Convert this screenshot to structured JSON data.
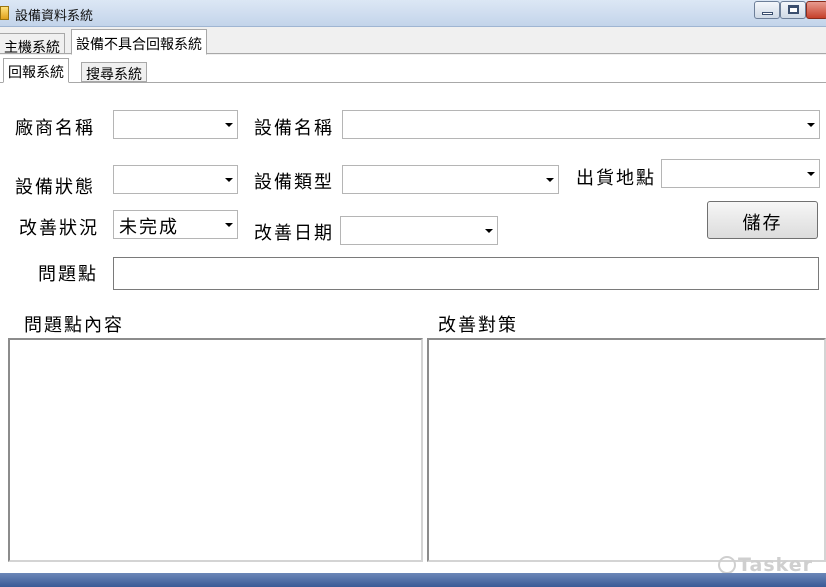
{
  "window": {
    "title": "設備資料系統"
  },
  "outer_tabs": [
    {
      "label": "主機系統"
    },
    {
      "label": "設備不具合回報系統"
    }
  ],
  "inner_tabs": [
    {
      "label": "回報系統"
    },
    {
      "label": "搜尋系統"
    }
  ],
  "form": {
    "vendor_label": "廠商名稱",
    "vendor_value": "",
    "equipment_name_label": "設備名稱",
    "equipment_name_value": "",
    "equipment_status_label": "設備狀態",
    "equipment_status_value": "",
    "equipment_type_label": "設備類型",
    "equipment_type_value": "",
    "shipping_location_label": "出貨地點",
    "shipping_location_value": "",
    "improvement_status_label": "改善狀況",
    "improvement_status_value": "未完成",
    "improvement_date_label": "改善日期",
    "improvement_date_value": "",
    "save_label": "儲存",
    "problem_point_label": "問題點",
    "problem_point_value": "",
    "problem_content_label": "問題點內容",
    "problem_content_value": "",
    "countermeasure_label": "改善對策",
    "countermeasure_value": ""
  },
  "watermark": {
    "text": "Tasker"
  }
}
